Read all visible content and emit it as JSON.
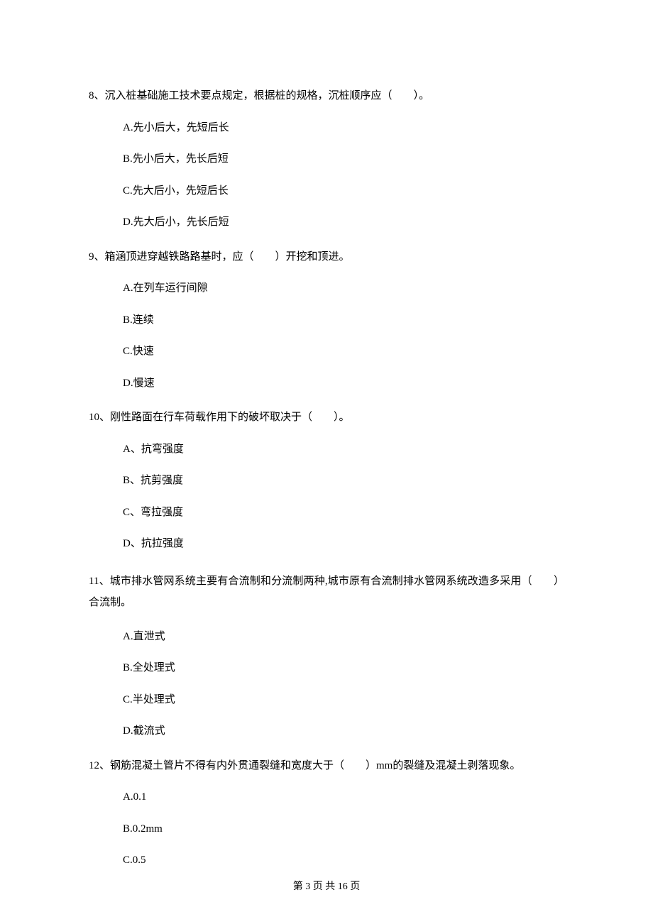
{
  "questions": [
    {
      "stem": "8、沉入桩基础施工技术要点规定，根据桩的规格，沉桩顺序应（　　）。",
      "options": [
        "A.先小后大，先短后长",
        "B.先小后大，先长后短",
        "C.先大后小，先短后长",
        "D.先大后小，先长后短"
      ]
    },
    {
      "stem": "9、箱涵顶进穿越铁路路基时，应（　　）开挖和顶进。",
      "options": [
        "A.在列车运行间隙",
        "B.连续",
        "C.快速",
        "D.慢速"
      ]
    },
    {
      "stem": "10、刚性路面在行车荷载作用下的破坏取决于（　　）。",
      "options": [
        "A、抗弯强度",
        "B、抗剪强度",
        "C、弯拉强度",
        "D、抗拉强度"
      ]
    },
    {
      "stem": "11、城市排水管网系统主要有合流制和分流制两种,城市原有合流制排水管网系统改造多采用（　　）合流制。",
      "options": [
        "A.直泄式",
        "B.全处理式",
        "C.半处理式",
        "D.截流式"
      ]
    },
    {
      "stem": "12、钢筋混凝土管片不得有内外贯通裂缝和宽度大于（　　）mm的裂缝及混凝土剥落现象。",
      "options": [
        "A.0.1",
        "B.0.2mm",
        "C.0.5"
      ]
    }
  ],
  "footer": "第 3 页 共 16 页"
}
